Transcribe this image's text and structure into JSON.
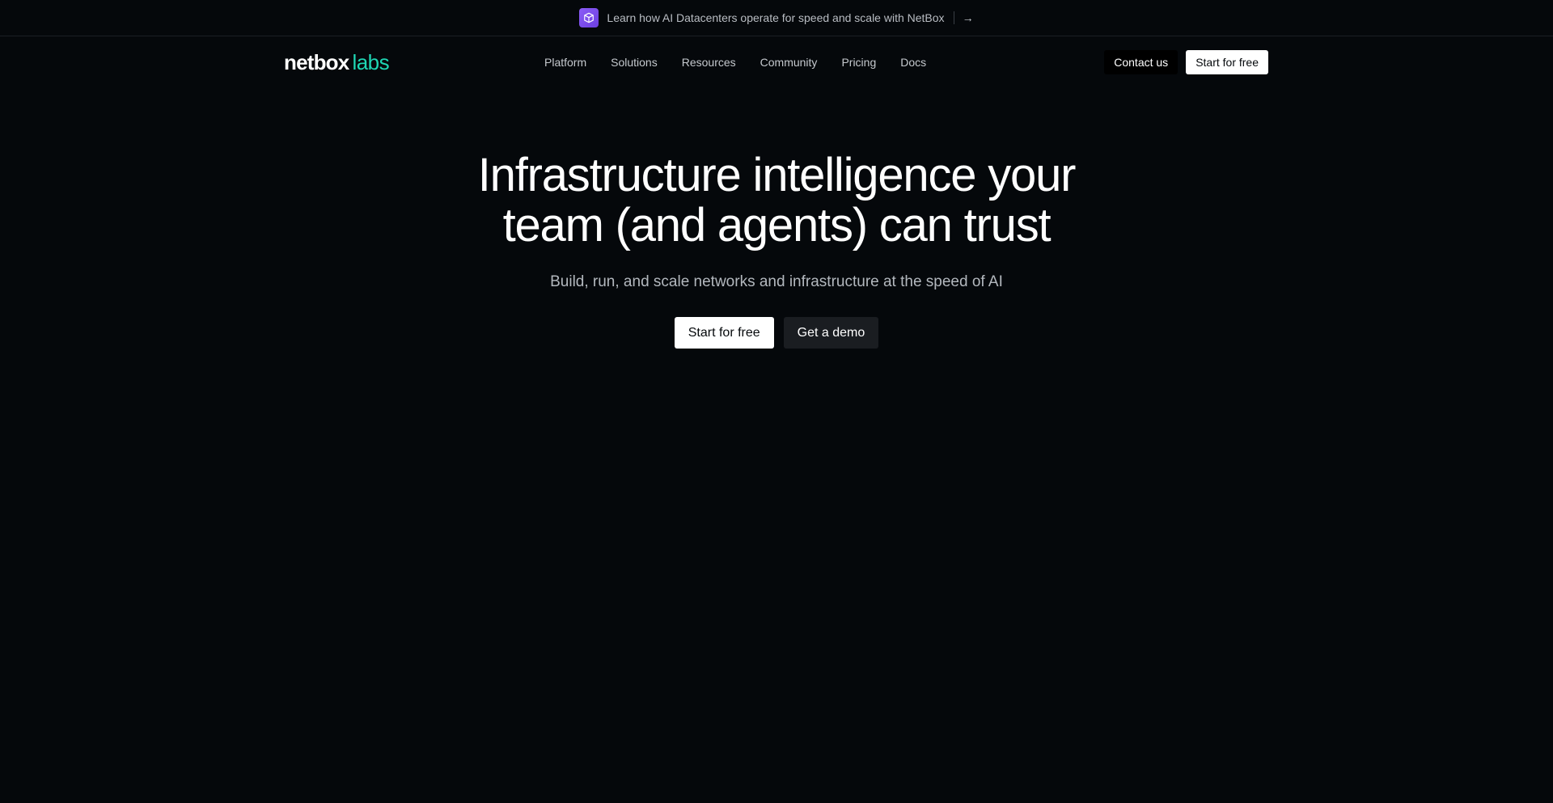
{
  "announcement": {
    "icon": "cube-icon",
    "text": "Learn how AI Datacenters operate for speed and scale with NetBox",
    "arrow": "→"
  },
  "nav": {
    "logo_primary": "netbox",
    "logo_secondary": "labs",
    "items": [
      {
        "label": "Platform"
      },
      {
        "label": "Solutions"
      },
      {
        "label": "Resources"
      },
      {
        "label": "Community"
      },
      {
        "label": "Pricing"
      },
      {
        "label": "Docs"
      }
    ],
    "contact_label": "Contact us",
    "start_label": "Start for free"
  },
  "hero": {
    "title_line1": "Infrastructure intelligence your",
    "title_line2": "team (and agents) can trust",
    "subtitle": "Build, run, and scale networks and infrastructure at the speed of AI",
    "primary_cta": "Start for free",
    "secondary_cta": "Get a demo"
  },
  "colors": {
    "background": "#05080b",
    "logo_accent": "#1fd6b4",
    "announce_icon": "#7c4dee"
  }
}
